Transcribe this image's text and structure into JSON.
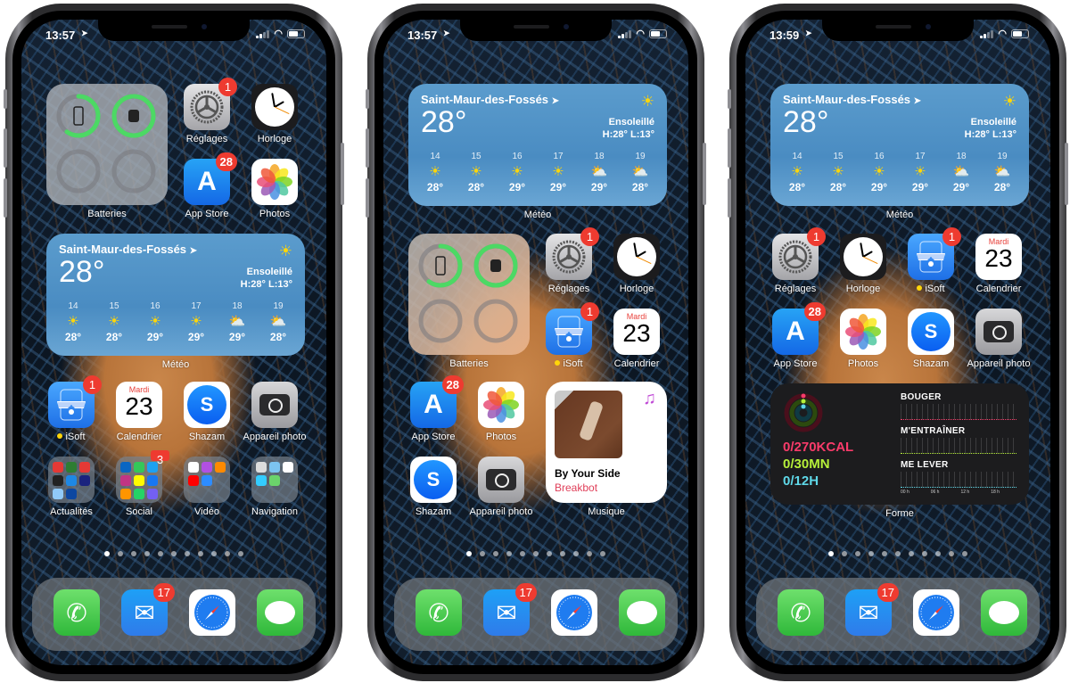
{
  "phones": [
    {
      "status": {
        "time": "13:57"
      },
      "widgets": {
        "batteries_label": "Batteries",
        "weather": {
          "city": "Saint-Maur-des-Fossés",
          "temp": "28°",
          "condition": "Ensoleillé",
          "hilo": "H:28° L:13°",
          "hours": [
            {
              "h": "14",
              "icon": "sun",
              "t": "28°"
            },
            {
              "h": "15",
              "icon": "sun",
              "t": "28°"
            },
            {
              "h": "16",
              "icon": "sun",
              "t": "29°"
            },
            {
              "h": "17",
              "icon": "sun",
              "t": "29°"
            },
            {
              "h": "18",
              "icon": "partly-cloudy",
              "t": "29°"
            },
            {
              "h": "19",
              "icon": "partly-cloudy",
              "t": "28°"
            }
          ],
          "label": "Météo"
        }
      },
      "apps": {
        "reglages": {
          "label": "Réglages",
          "badge": "1"
        },
        "horloge": {
          "label": "Horloge"
        },
        "appstore": {
          "label": "App Store",
          "badge": "28"
        },
        "photos": {
          "label": "Photos"
        },
        "isoft": {
          "label": "iSoft",
          "badge": "1"
        },
        "calendrier": {
          "label": "Calendrier",
          "day": "Mardi",
          "date": "23"
        },
        "shazam": {
          "label": "Shazam"
        },
        "camera": {
          "label": "Appareil photo"
        },
        "folder_actualites": {
          "label": "Actualités"
        },
        "folder_social": {
          "label": "Social",
          "badge": "3"
        },
        "folder_video": {
          "label": "Vidéo"
        },
        "folder_navigation": {
          "label": "Navigation"
        }
      },
      "dock": {
        "mail_badge": "17"
      }
    },
    {
      "status": {
        "time": "13:57"
      },
      "widgets": {
        "batteries_label": "Batteries",
        "weather": {
          "city": "Saint-Maur-des-Fossés",
          "temp": "28°",
          "condition": "Ensoleillé",
          "hilo": "H:28° L:13°",
          "hours": [
            {
              "h": "14",
              "icon": "sun",
              "t": "28°"
            },
            {
              "h": "15",
              "icon": "sun",
              "t": "28°"
            },
            {
              "h": "16",
              "icon": "sun",
              "t": "29°"
            },
            {
              "h": "17",
              "icon": "sun",
              "t": "29°"
            },
            {
              "h": "18",
              "icon": "partly-cloudy",
              "t": "29°"
            },
            {
              "h": "19",
              "icon": "partly-cloudy",
              "t": "28°"
            }
          ],
          "label": "Météo"
        },
        "music": {
          "title": "By Your Side",
          "artist": "Breakbot",
          "label": "Musique"
        }
      },
      "apps": {
        "reglages": {
          "label": "Réglages",
          "badge": "1"
        },
        "horloge": {
          "label": "Horloge"
        },
        "isoft": {
          "label": "iSoft",
          "badge": "1"
        },
        "calendrier": {
          "label": "Calendrier",
          "day": "Mardi",
          "date": "23"
        },
        "appstore": {
          "label": "App Store",
          "badge": "28"
        },
        "photos": {
          "label": "Photos"
        },
        "shazam": {
          "label": "Shazam"
        },
        "camera": {
          "label": "Appareil photo"
        }
      },
      "dock": {
        "mail_badge": "17"
      }
    },
    {
      "status": {
        "time": "13:59"
      },
      "widgets": {
        "weather": {
          "city": "Saint-Maur-des-Fossés",
          "temp": "28°",
          "condition": "Ensoleillé",
          "hilo": "H:28° L:13°",
          "hours": [
            {
              "h": "14",
              "icon": "sun",
              "t": "28°"
            },
            {
              "h": "15",
              "icon": "sun",
              "t": "28°"
            },
            {
              "h": "16",
              "icon": "sun",
              "t": "29°"
            },
            {
              "h": "17",
              "icon": "sun",
              "t": "29°"
            },
            {
              "h": "18",
              "icon": "partly-cloudy",
              "t": "29°"
            },
            {
              "h": "19",
              "icon": "partly-cloudy",
              "t": "28°"
            }
          ],
          "label": "Météo"
        },
        "fitness": {
          "move": "0/270KCAL",
          "exercise": "0/30MN",
          "stand": "0/12H",
          "sections": [
            "BOUGER",
            "M'ENTRAÎNER",
            "ME LEVER"
          ],
          "axis": [
            "00 h",
            "06 h",
            "12 h",
            "18 h"
          ],
          "label": "Forme"
        }
      },
      "apps": {
        "reglages": {
          "label": "Réglages",
          "badge": "1"
        },
        "horloge": {
          "label": "Horloge"
        },
        "isoft": {
          "label": "iSoft",
          "badge": "1"
        },
        "calendrier": {
          "label": "Calendrier",
          "day": "Mardi",
          "date": "23"
        },
        "appstore": {
          "label": "App Store",
          "badge": "28"
        },
        "photos": {
          "label": "Photos"
        },
        "shazam": {
          "label": "Shazam"
        },
        "camera": {
          "label": "Appareil photo"
        }
      },
      "dock": {
        "mail_badge": "17"
      }
    }
  ],
  "page_dots": {
    "count": 11,
    "active_index": 0
  },
  "battery_levels": {
    "phone": 0.6,
    "watch": 0.98
  },
  "icons": {
    "sun": "☀",
    "partly-cloudy": "⛅",
    "location": "➤",
    "music-note": "♫",
    "phone": "✆",
    "mail": "✉",
    "appstore": "A",
    "shazam": "S"
  },
  "colors": {
    "badge": "#ee3b30",
    "move": "#fa3b6a",
    "exercise": "#b6f03a",
    "stand": "#5fd8e8",
    "calendar_day": "#e8403a",
    "artist": "#e0405a"
  }
}
